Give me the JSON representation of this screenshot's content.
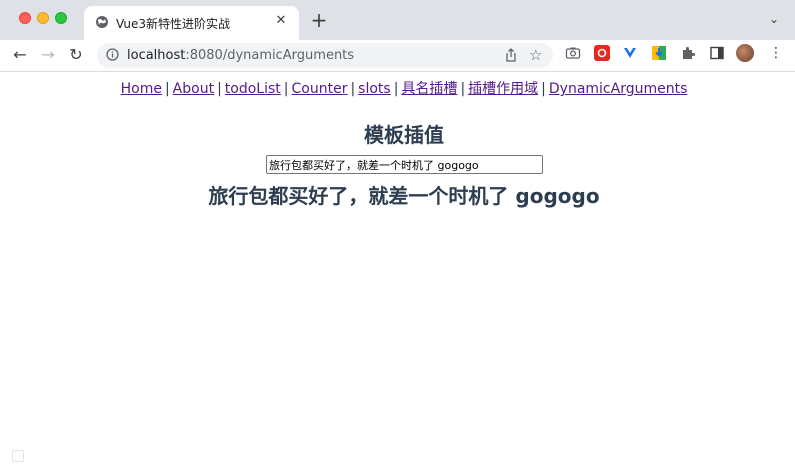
{
  "browser": {
    "tab_title": "Vue3新特性进阶实战",
    "tab_close": "✕",
    "new_tab": "+",
    "tab_menu": "⌄",
    "url_host": "localhost",
    "url_rest": ":8080/dynamicArguments",
    "icons": [
      "globe-icon",
      "back-icon",
      "forward-icon",
      "reload-icon",
      "info-icon",
      "share-icon",
      "star-icon",
      "camera-icon",
      "extension-icon",
      "puzzle-icon",
      "side-panel-icon",
      "profile-avatar",
      "kebab-menu-icon"
    ]
  },
  "nav": {
    "items": [
      "Home",
      "About",
      "todoList",
      "Counter",
      "slots",
      "具名插槽",
      "插槽作用域",
      "DynamicArguments"
    ],
    "separator": "|"
  },
  "main": {
    "heading": "模板插值",
    "input_value": "旅行包都买好了，就差一个时机了 gogogo",
    "echo_text": "旅行包都买好了，就差一个时机了 gogogo"
  }
}
